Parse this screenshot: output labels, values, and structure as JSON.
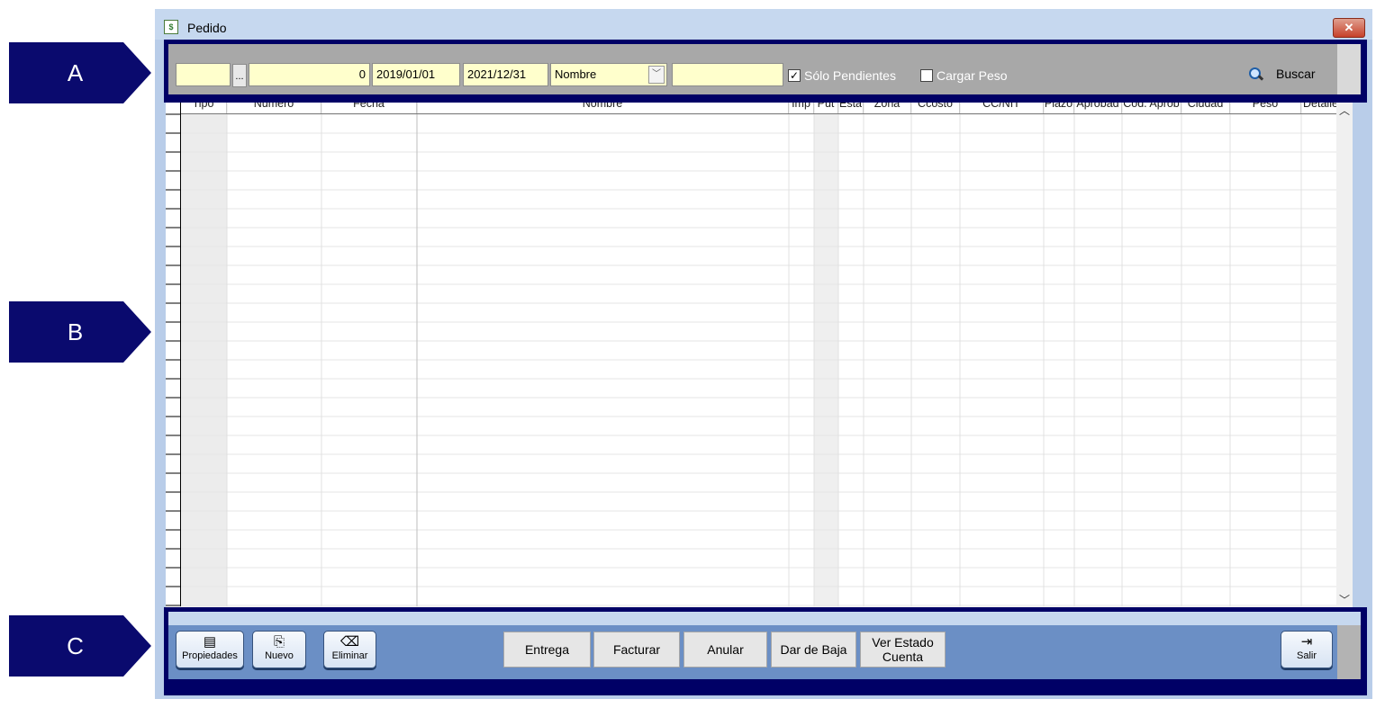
{
  "callouts": {
    "a": "A",
    "b": "B",
    "c": "C"
  },
  "window": {
    "title": "Pedido",
    "close": "✕"
  },
  "filters": {
    "code_value": "",
    "ellipsis": "...",
    "number_value": "0",
    "date_from": "2019/01/01",
    "date_to": "2021/12/31",
    "field_selected": "Nombre",
    "search_text": "",
    "only_pending_label": "Sólo Pendientes",
    "only_pending_checked": true,
    "load_weight_label": "Cargar Peso",
    "load_weight_checked": false,
    "search_button": "Buscar"
  },
  "grid": {
    "columns": [
      "Tipo",
      "Número",
      "Fecha",
      "Nombre",
      "Imp",
      "Put",
      "Esta",
      "Zona",
      "Ccosto",
      "CC/NIT",
      "Plazo",
      "Aprobad",
      "Cód. Aprob",
      "Ciudad",
      "Peso",
      "Detalle"
    ],
    "rows": []
  },
  "footer": {
    "propiedades": "Propiedades",
    "nuevo": "Nuevo",
    "eliminar": "Eliminar",
    "entrega": "Entrega",
    "facturar": "Facturar",
    "anular": "Anular",
    "dar_de_baja": "Dar de Baja",
    "ver_estado_1": "Ver Estado",
    "ver_estado_2": "Cuenta",
    "salir": "Salir"
  },
  "colors": {
    "callout": "#0a0a6e",
    "frame": "#000066",
    "toolbar": "#a8a8a8",
    "footer": "#6b8fc5",
    "input_bg": "#ffffcc"
  }
}
